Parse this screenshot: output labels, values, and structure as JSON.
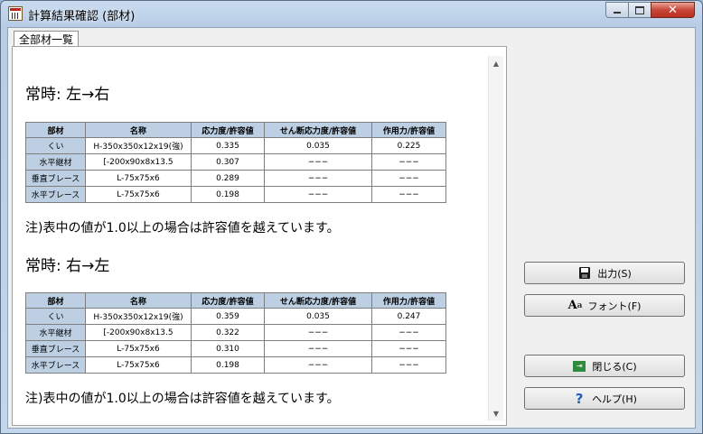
{
  "window": {
    "title": "計算結果確認 (部材)",
    "controls": {
      "minimize": "",
      "maximize": "",
      "close": "✕"
    }
  },
  "tab": {
    "label": "全部材一覧"
  },
  "sections": [
    {
      "heading": "常時:  左→右",
      "headers": [
        "部材",
        "名称",
        "応力度/許容値",
        "せん断応力度/許容値",
        "作用力/許容値"
      ],
      "rows": [
        [
          "くい",
          "H-350x350x12x19(強)",
          "0.335",
          "0.035",
          "0.225"
        ],
        [
          "水平継材",
          "[-200x90x8x13.5",
          "0.307",
          "−−−",
          "−−−"
        ],
        [
          "垂直ブレース",
          "L-75x75x6",
          "0.289",
          "−−−",
          "−−−"
        ],
        [
          "水平ブレース",
          "L-75x75x6",
          "0.198",
          "−−−",
          "−−−"
        ]
      ],
      "note": "注)表中の値が1.0以上の場合は許容値を越えています。"
    },
    {
      "heading": "常時:  右→左",
      "headers": [
        "部材",
        "名称",
        "応力度/許容値",
        "せん断応力度/許容値",
        "作用力/許容値"
      ],
      "rows": [
        [
          "くい",
          "H-350x350x12x19(強)",
          "0.359",
          "0.035",
          "0.247"
        ],
        [
          "水平継材",
          "[-200x90x8x13.5",
          "0.322",
          "−−−",
          "−−−"
        ],
        [
          "垂直ブレース",
          "L-75x75x6",
          "0.310",
          "−−−",
          "−−−"
        ],
        [
          "水平ブレース",
          "L-75x75x6",
          "0.198",
          "−−−",
          "−−−"
        ]
      ],
      "note": "注)表中の値が1.0以上の場合は許容値を越えています。"
    }
  ],
  "buttons": {
    "output": "出力(S)",
    "font": "フォント(F)",
    "close": "閉じる(C)",
    "help": "ヘルプ(H)"
  },
  "icons": {
    "app": "table-app-icon",
    "output": "floppy-disk-icon",
    "font": "font-icon",
    "close": "exit-icon",
    "help": "question-mark-icon"
  },
  "colors": {
    "table_header": "#bccfe3",
    "frame": "#b7cde6",
    "close_button": "#c8473a"
  }
}
